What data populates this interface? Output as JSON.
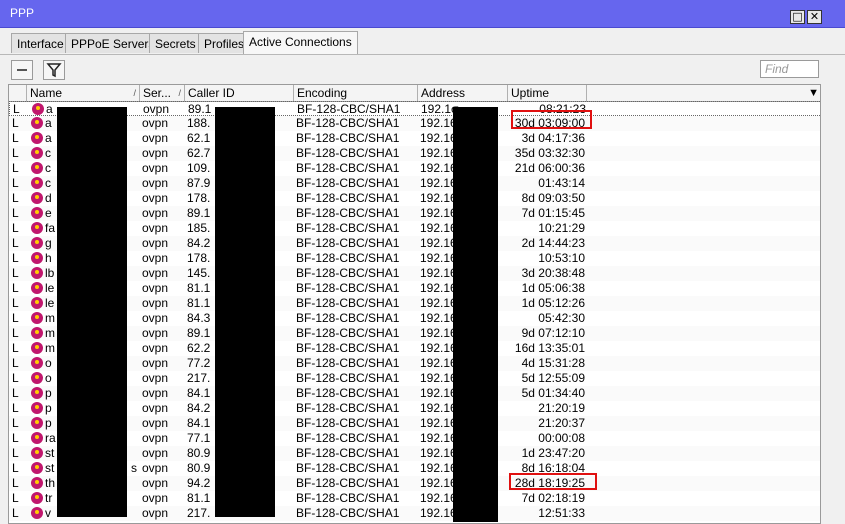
{
  "window": {
    "title": "PPP"
  },
  "tabs": [
    {
      "label": "Interface",
      "active": false
    },
    {
      "label": "PPPoE Servers",
      "active": false
    },
    {
      "label": "Secrets",
      "active": false
    },
    {
      "label": "Profiles",
      "active": false
    },
    {
      "label": "Active Connections",
      "active": true
    }
  ],
  "toolbar": {
    "find_placeholder": "Find",
    "remove_icon": "minus-icon",
    "filter_icon": "filter-icon"
  },
  "columns": [
    "Name",
    "Ser...",
    "Caller ID",
    "Encoding",
    "Address",
    "Uptime"
  ],
  "rows": [
    {
      "flag": "L",
      "name": "a",
      "service": "ovpn",
      "caller": "89.1",
      "encoding": "BF-128-CBC/SHA1",
      "address": "192.1σ",
      "uptime": "08:21:23",
      "selected": true
    },
    {
      "flag": "L",
      "name": "a",
      "service": "ovpn",
      "caller": "188.",
      "encoding": "BF-128-CBC/SHA1",
      "address": "192.16",
      "uptime": "30d 03:09:00",
      "highlight": true
    },
    {
      "flag": "L",
      "name": "a",
      "service": "ovpn",
      "caller": "62.1",
      "encoding": "BF-128-CBC/SHA1",
      "address": "192.16",
      "uptime": "3d 04:17:36"
    },
    {
      "flag": "L",
      "name": "c",
      "service": "ovpn",
      "caller": "62.7",
      "encoding": "BF-128-CBC/SHA1",
      "address": "192.16",
      "uptime": "35d 03:32:30"
    },
    {
      "flag": "L",
      "name": "c",
      "service": "ovpn",
      "caller": "109.",
      "encoding": "BF-128-CBC/SHA1",
      "address": "192.16",
      "uptime": "21d 06:00:36"
    },
    {
      "flag": "L",
      "name": "c",
      "service": "ovpn",
      "caller": "87.9",
      "encoding": "BF-128-CBC/SHA1",
      "address": "192.16",
      "uptime": "01:43:14"
    },
    {
      "flag": "L",
      "name": "d",
      "service": "ovpn",
      "caller": "178.",
      "encoding": "BF-128-CBC/SHA1",
      "address": "192.16",
      "uptime": "8d 09:03:50"
    },
    {
      "flag": "L",
      "name": "e",
      "service": "ovpn",
      "caller": "89.1",
      "encoding": "BF-128-CBC/SHA1",
      "address": "192.16",
      "uptime": "7d 01:15:45"
    },
    {
      "flag": "L",
      "name": "fa",
      "service": "ovpn",
      "caller": "185.",
      "encoding": "BF-128-CBC/SHA1",
      "address": "192.16",
      "uptime": "10:21:29"
    },
    {
      "flag": "L",
      "name": "g",
      "service": "ovpn",
      "caller": "84.2",
      "encoding": "BF-128-CBC/SHA1",
      "address": "192.16",
      "uptime": "2d 14:44:23"
    },
    {
      "flag": "L",
      "name": "h",
      "service": "ovpn",
      "caller": "178.",
      "encoding": "BF-128-CBC/SHA1",
      "address": "192.16",
      "uptime": "10:53:10"
    },
    {
      "flag": "L",
      "name": "lb",
      "service": "ovpn",
      "caller": "145.",
      "encoding": "BF-128-CBC/SHA1",
      "address": "192.16",
      "uptime": "3d 20:38:48"
    },
    {
      "flag": "L",
      "name": "le",
      "service": "ovpn",
      "caller": "81.1",
      "encoding": "BF-128-CBC/SHA1",
      "address": "192.16",
      "uptime": "1d 05:06:38"
    },
    {
      "flag": "L",
      "name": "le",
      "service": "ovpn",
      "caller": "81.1",
      "encoding": "BF-128-CBC/SHA1",
      "address": "192.16",
      "uptime": "1d 05:12:26"
    },
    {
      "flag": "L",
      "name": "m",
      "service": "ovpn",
      "caller": "84.3",
      "encoding": "BF-128-CBC/SHA1",
      "address": "192.16",
      "uptime": "05:42:30"
    },
    {
      "flag": "L",
      "name": "m",
      "service": "ovpn",
      "caller": "89.1",
      "encoding": "BF-128-CBC/SHA1",
      "address": "192.16",
      "uptime": "9d 07:12:10"
    },
    {
      "flag": "L",
      "name": "m",
      "service": "ovpn",
      "caller": "62.2",
      "encoding": "BF-128-CBC/SHA1",
      "address": "192.16",
      "uptime": "16d 13:35:01"
    },
    {
      "flag": "L",
      "name": "o",
      "service": "ovpn",
      "caller": "77.2",
      "encoding": "BF-128-CBC/SHA1",
      "address": "192.16",
      "uptime": "4d 15:31:28"
    },
    {
      "flag": "L",
      "name": "o",
      "service": "ovpn",
      "caller": "217.",
      "encoding": "BF-128-CBC/SHA1",
      "address": "192.16",
      "uptime": "5d 12:55:09"
    },
    {
      "flag": "L",
      "name": "p",
      "service": "ovpn",
      "caller": "84.1",
      "encoding": "BF-128-CBC/SHA1",
      "address": "192.16",
      "uptime": "5d 01:34:40"
    },
    {
      "flag": "L",
      "name": "p",
      "service": "ovpn",
      "caller": "84.2",
      "encoding": "BF-128-CBC/SHA1",
      "address": "192.16",
      "uptime": "21:20:19"
    },
    {
      "flag": "L",
      "name": "p",
      "service": "ovpn",
      "caller": "84.1",
      "encoding": "BF-128-CBC/SHA1",
      "address": "192.16",
      "uptime": "21:20:37"
    },
    {
      "flag": "L",
      "name": "ra",
      "service": "ovpn",
      "caller": "77.1",
      "encoding": "BF-128-CBC/SHA1",
      "address": "192.16",
      "uptime": "00:00:08"
    },
    {
      "flag": "L",
      "name": "st",
      "service": "ovpn",
      "caller": "80.9",
      "encoding": "BF-128-CBC/SHA1",
      "address": "192.16",
      "uptime": "1d 23:47:20"
    },
    {
      "flag": "L",
      "name": "st",
      "service": "ovpn",
      "caller": "80.9",
      "encoding": "BF-128-CBC/SHA1",
      "address": "192.16",
      "uptime": "8d 16:18:04",
      "marker": "s"
    },
    {
      "flag": "L",
      "name": "th",
      "service": "ovpn",
      "caller": "94.2",
      "encoding": "BF-128-CBC/SHA1",
      "address": "192.16",
      "uptime": "28d 18:19:25",
      "highlight": true
    },
    {
      "flag": "L",
      "name": "tr",
      "service": "ovpn",
      "caller": "81.1",
      "encoding": "BF-128-CBC/SHA1",
      "address": "192.16",
      "uptime": "7d 02:18:19"
    },
    {
      "flag": "L",
      "name": "v",
      "service": "ovpn",
      "caller": "217.",
      "encoding": "BF-128-CBC/SHA1",
      "address": "192.16",
      "uptime": "12:51:33"
    }
  ],
  "colors": {
    "titlebar": "#6666ee",
    "highlight": "#e01010",
    "user_icon": "#c0176d"
  }
}
